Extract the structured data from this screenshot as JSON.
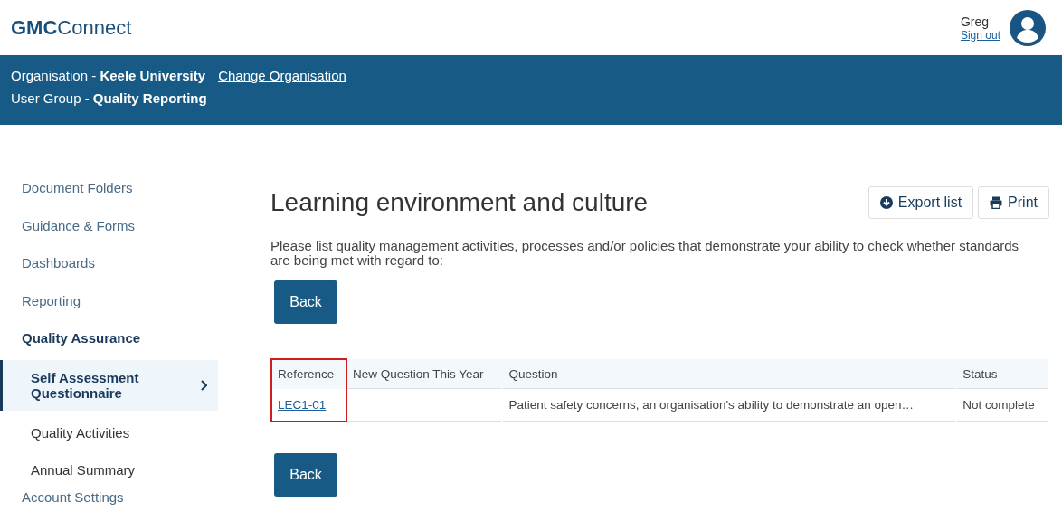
{
  "header": {
    "logo": "**GMC**Connect",
    "user_name": "Greg",
    "sign_out": "Sign out"
  },
  "context_bar": {
    "organisation_label": "Organisation - ",
    "organisation": "Keele University",
    "change_link": "Change Organisation",
    "group_label": "User Group - ",
    "group": "Quality Reporting"
  },
  "sidebar": {
    "items": [
      {
        "label": "Document Folders",
        "selected": false
      },
      {
        "label": "Guidance & Forms",
        "selected": false
      },
      {
        "label": "Dashboards",
        "selected": false
      },
      {
        "label": "Reporting",
        "selected": false
      },
      {
        "label": "Quality Assurance",
        "selected": false,
        "expanded": true,
        "children": [
          {
            "label": "Self Assessment Questionnaire",
            "selected": true
          },
          {
            "label": "Quality Activities",
            "selected": false
          },
          {
            "label": "Annual Summary",
            "selected": false
          }
        ]
      },
      {
        "label": "Account Settings",
        "selected": false
      }
    ]
  },
  "page": {
    "title": "Learning environment and culture",
    "actions": [
      {
        "label": "Export list",
        "kind": "export"
      },
      {
        "label": "Print",
        "kind": "print"
      }
    ],
    "description": "Please list quality management activities, processes and/or policies that demonstrate your ability to check whether standards are being met with regard to:",
    "back_buttons": [
      "Back",
      "Back"
    ]
  },
  "table": {
    "columns": [
      {
        "label": "Reference",
        "highlighted": true
      },
      {
        "label": "New Question This Year",
        "highlighted": false
      },
      {
        "label": "Question",
        "highlighted": false
      },
      {
        "label": "Status",
        "highlighted": false
      }
    ],
    "rows": [
      {
        "reference": "LEC1-01",
        "question": "Patient safety concerns, an organisation's ability to demonstrate an open…",
        "status": "Not complete"
      }
    ]
  }
}
